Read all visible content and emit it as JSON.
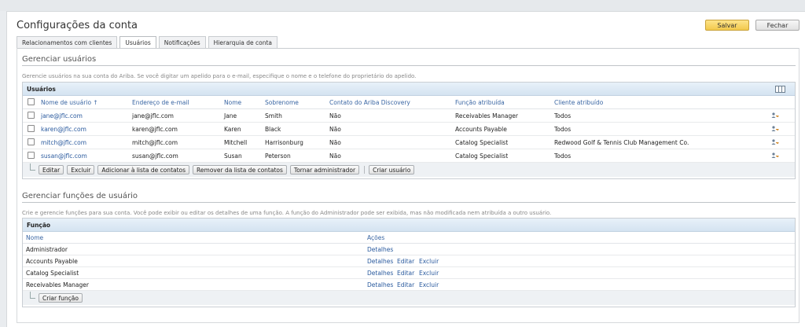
{
  "page": {
    "title": "Configurações da conta",
    "save_label": "Salvar",
    "close_label": "Fechar"
  },
  "tabs": [
    {
      "label": "Relacionamentos com clientes",
      "active": false
    },
    {
      "label": "Usuários",
      "active": true
    },
    {
      "label": "Notificações",
      "active": false
    },
    {
      "label": "Hierarquia de conta",
      "active": false
    }
  ],
  "users_section": {
    "title": "Gerenciar usuários",
    "description": "Gerencie usuários na sua conta do Ariba. Se você digitar um apelido para o e-mail, especifique o nome e o telefone do proprietário do apelido.",
    "table_title": "Usuários",
    "columns": [
      "Nome de usuário ↑",
      "Endereço de e-mail",
      "Nome",
      "Sobrenome",
      "Contato do Ariba Discovery",
      "Função atribuída",
      "Cliente atribuído"
    ],
    "rows": [
      {
        "username": "jane@jflc.com",
        "email": "jane@jflc.com",
        "first": "Jane",
        "last": "Smith",
        "discovery": "Não",
        "role": "Receivables Manager",
        "customer": "Todos"
      },
      {
        "username": "karen@jflc.com",
        "email": "karen@jflc.com",
        "first": "Karen",
        "last": "Black",
        "discovery": "Não",
        "role": "Accounts Payable",
        "customer": "Todos"
      },
      {
        "username": "mitch@jflc.com",
        "email": "mitch@jflc.com",
        "first": "Mitchell",
        "last": "Harrisonburg",
        "discovery": "Não",
        "role": "Catalog Specialist",
        "customer": "Redwood Golf & Tennis Club Management Co."
      },
      {
        "username": "susan@jflc.com",
        "email": "susan@jflc.com",
        "first": "Susan",
        "last": "Peterson",
        "discovery": "Não",
        "role": "Catalog Specialist",
        "customer": "Todos"
      }
    ],
    "actions": [
      "Editar",
      "Excluir",
      "Adicionar à lista de contatos",
      "Remover da lista de contatos",
      "Tornar administrador"
    ],
    "create_label": "Criar usuário"
  },
  "roles_section": {
    "title": "Gerenciar funções de usuário",
    "description": "Crie e gerencie funções para sua conta. Você pode exibir ou editar os detalhes de uma função. A função do Administrador pode ser exibida, mas não modificada nem atribuída a outro usuário.",
    "table_title": "Função",
    "col_name": "Nome",
    "col_actions": "Ações",
    "rows": [
      {
        "name": "Administrador",
        "details": "Detalhes",
        "edit": "",
        "delete": ""
      },
      {
        "name": "Accounts Payable",
        "details": "Detalhes",
        "edit": "Editar",
        "delete": "Excluir"
      },
      {
        "name": "Catalog Specialist",
        "details": "Detalhes",
        "edit": "Editar",
        "delete": "Excluir"
      },
      {
        "name": "Receivables Manager",
        "details": "Detalhes",
        "edit": "Editar",
        "delete": "Excluir"
      }
    ],
    "create_label": "Criar função"
  },
  "icons": {
    "table_options": "column-chooser-icon",
    "row_action": "user-key-icon"
  }
}
